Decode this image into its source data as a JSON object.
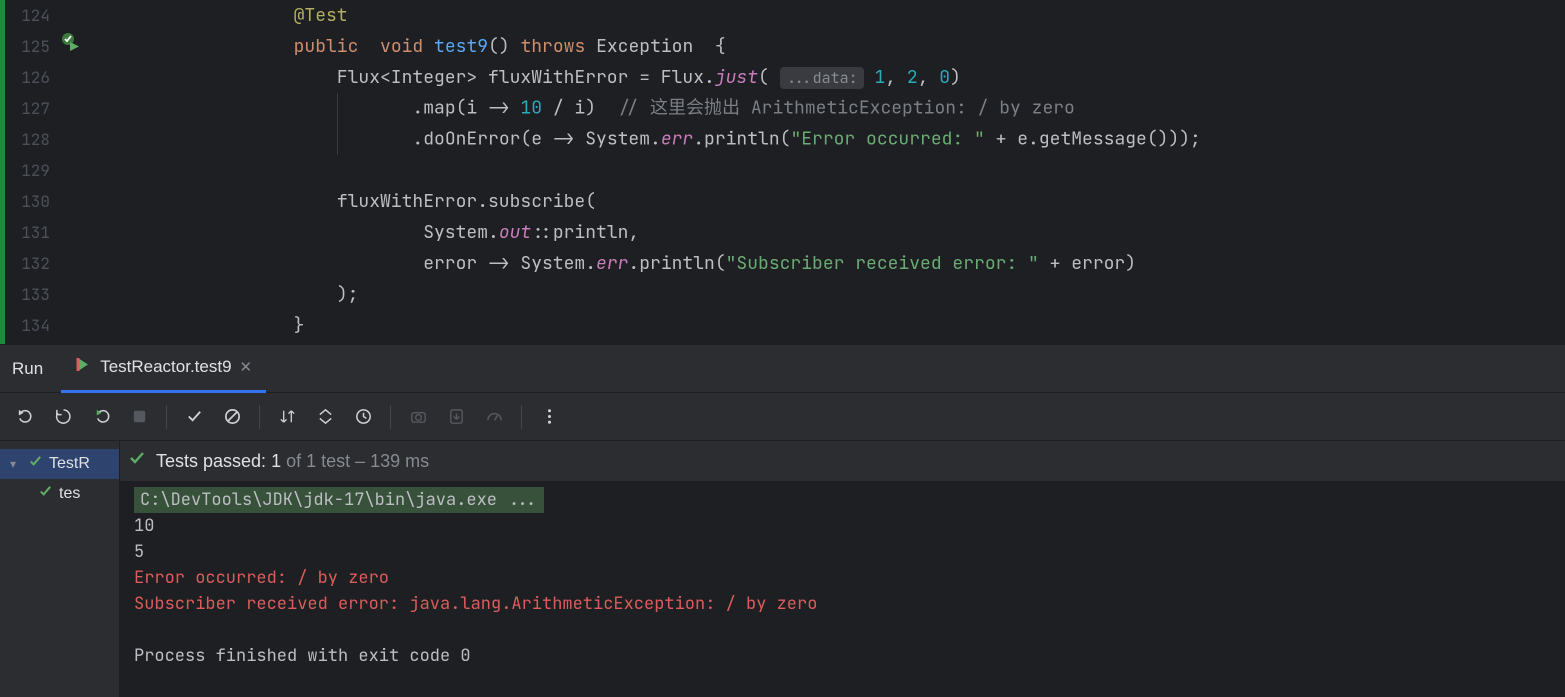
{
  "editor": {
    "lines": [
      {
        "n": 124,
        "indent": 3,
        "tokens": [
          [
            "k-ann",
            "@Test"
          ]
        ]
      },
      {
        "n": 125,
        "indent": 3,
        "runIcon": true,
        "tokens": [
          [
            "k-kw",
            "public"
          ],
          [
            "k-punc",
            "  "
          ],
          [
            "k-kw",
            "void"
          ],
          [
            "k-punc",
            " "
          ],
          [
            "k-decl",
            "test9"
          ],
          [
            "k-punc",
            "() "
          ],
          [
            "k-kw",
            "throws"
          ],
          [
            "k-punc",
            " "
          ],
          [
            "k-type",
            "Exception"
          ],
          [
            "k-punc",
            "  {"
          ]
        ]
      },
      {
        "n": 126,
        "indent": 4,
        "tokens": [
          [
            "k-type",
            "Flux<Integer> fluxWithError = Flux."
          ],
          [
            "k-ital",
            "just"
          ],
          [
            "k-punc",
            "( "
          ],
          [
            "hint",
            "...data:"
          ],
          [
            "k-punc",
            " "
          ],
          [
            "k-num",
            "1"
          ],
          [
            "k-punc",
            ", "
          ],
          [
            "k-num",
            "2"
          ],
          [
            "k-punc",
            ", "
          ],
          [
            "k-num",
            "0"
          ],
          [
            "k-punc",
            ")"
          ]
        ]
      },
      {
        "n": 127,
        "indent": 6,
        "guide": 4,
        "tokens": [
          [
            "k-punc",
            ".map(i -> "
          ],
          [
            "k-num",
            "10"
          ],
          [
            "k-punc",
            " / i)  "
          ],
          [
            "k-comm",
            "// 这里会抛出 ArithmeticException: / by zero"
          ]
        ]
      },
      {
        "n": 128,
        "indent": 6,
        "guide": 4,
        "tokens": [
          [
            "k-punc",
            ".doOnError(e -> System."
          ],
          [
            "k-field",
            "err"
          ],
          [
            "k-punc",
            ".println("
          ],
          [
            "k-str",
            "\"Error occurred: \""
          ],
          [
            "k-punc",
            " + e.getMessage()));"
          ]
        ]
      },
      {
        "n": 129,
        "indent": 0,
        "tokens": []
      },
      {
        "n": 130,
        "indent": 4,
        "tokens": [
          [
            "k-punc",
            "fluxWithError.subscribe("
          ]
        ]
      },
      {
        "n": 131,
        "indent": 6,
        "tokens": [
          [
            "k-punc",
            "System."
          ],
          [
            "k-field",
            "out"
          ],
          [
            "k-punc",
            "::println,"
          ]
        ]
      },
      {
        "n": 132,
        "indent": 6,
        "tokens": [
          [
            "k-punc",
            "error -> System."
          ],
          [
            "k-field",
            "err"
          ],
          [
            "k-punc",
            ".println("
          ],
          [
            "k-str",
            "\"Subscriber received error: \""
          ],
          [
            "k-punc",
            " + error)"
          ]
        ]
      },
      {
        "n": 133,
        "indent": 4,
        "tokens": [
          [
            "k-punc",
            ");"
          ]
        ]
      },
      {
        "n": 134,
        "indent": 3,
        "tokens": [
          [
            "k-punc",
            "}"
          ]
        ]
      }
    ]
  },
  "runPanel": {
    "title": "Run",
    "tabLabel": "TestReactor.test9",
    "status": {
      "passedPrefix": "Tests passed: ",
      "passedCount": "1",
      "suffix": " of 1 test – 139 ms"
    },
    "tree": {
      "root": "TestR",
      "child": "tes"
    },
    "console": {
      "cmd": "C:\\DevTools\\JDK\\jdk-17\\bin\\java.exe ...",
      "out": [
        "10",
        "5"
      ],
      "err": [
        "Error occurred: / by zero",
        "Subscriber received error: java.lang.ArithmeticException: / by zero"
      ],
      "exit": "Process finished with exit code 0"
    }
  }
}
